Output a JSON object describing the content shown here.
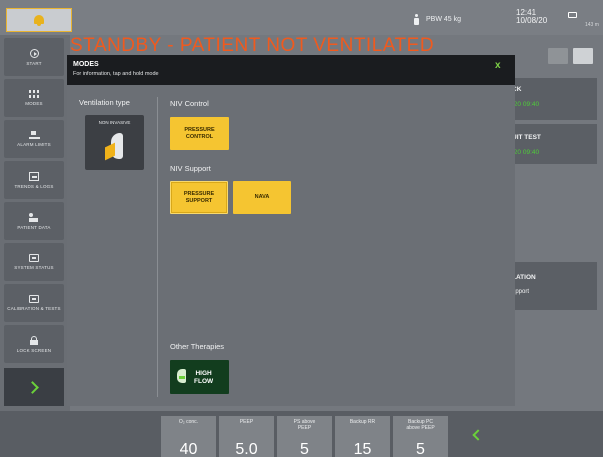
{
  "topbar": {
    "pbw": "PBW 45 kg",
    "time": "12:41",
    "date": "10/08/20",
    "battery_pct": "143 m"
  },
  "status_title": "STANDBY - PATIENT NOT VENTILATED",
  "sidebar": {
    "items": [
      {
        "label": "START",
        "icon": "start-icon"
      },
      {
        "label": "MODES",
        "icon": "modes-icon"
      },
      {
        "label": "ALARM LIMITS",
        "icon": "alarm-limits-icon"
      },
      {
        "label": "TRENDS & LOGS",
        "icon": "trends-icon"
      },
      {
        "label": "PATIENT DATA",
        "icon": "patient-icon"
      },
      {
        "label": "SYSTEM STATUS",
        "icon": "system-icon"
      },
      {
        "label": "CALIBRATION & TESTS",
        "icon": "calibration-icon"
      },
      {
        "label": "LOCK SCREEN",
        "icon": "lock-icon"
      }
    ]
  },
  "right_panels": {
    "p1": {
      "title": "CK",
      "value": "/20 09:40"
    },
    "p2": {
      "title": "UIT TEST",
      "value": "/20 09:40"
    },
    "p3": {
      "title": "LATION",
      "value": "upport"
    }
  },
  "modal": {
    "title": "MODES",
    "subtitle": "For information, tap and hold mode",
    "close": "x",
    "ventilation_type_label": "Ventilation type",
    "ventilation_type_value": "NON INVASIVE",
    "niv_control_label": "NIV Control",
    "pressure_control": "PRESSURE\nCONTROL",
    "niv_support_label": "NIV Support",
    "pressure_support": "PRESSURE\nSUPPORT",
    "nava": "NAVA",
    "other_therapies_label": "Other Therapies",
    "high_flow": "HIGH\nFLOW"
  },
  "settings": [
    {
      "name": "O₂ conc.",
      "value": "40"
    },
    {
      "name": "PEEP",
      "value": "5.0"
    },
    {
      "name": "PS above\nPEEP",
      "value": "5"
    },
    {
      "name": "Backup RR",
      "value": "15"
    },
    {
      "name": "Backup PC\nabove PEEP",
      "value": "5"
    }
  ],
  "colors": {
    "status": "#f05a1e",
    "accent_yellow": "#f5c531",
    "accent_green": "#6bd13a"
  }
}
